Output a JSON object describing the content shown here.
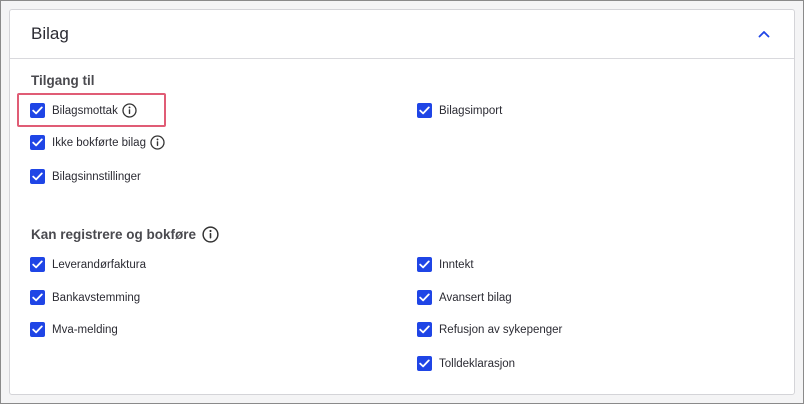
{
  "card": {
    "title": "Bilag",
    "collapse_icon": "chevron-up-icon",
    "accent_color": "#1f45e6",
    "highlight_color": "#e05c75"
  },
  "access": {
    "title": "Tilgang til",
    "items": [
      {
        "label": "Bilagsmottak",
        "checked": true,
        "info": true,
        "highlighted": true
      },
      {
        "label": "Ikke bokførte bilag",
        "checked": true,
        "info": true
      },
      {
        "label": "Bilagsinnstillinger",
        "checked": true
      },
      {
        "label": "Bilagsimport",
        "checked": true
      }
    ]
  },
  "register": {
    "title": "Kan registrere og bokføre",
    "title_info": true,
    "items": [
      {
        "label": "Leverandørfaktura",
        "checked": true
      },
      {
        "label": "Bankavstemming",
        "checked": true
      },
      {
        "label": "Mva-melding",
        "checked": true
      },
      {
        "label": "Inntekt",
        "checked": true
      },
      {
        "label": "Avansert bilag",
        "checked": true
      },
      {
        "label": "Refusjon av sykepenger",
        "checked": true
      },
      {
        "label": "Tolldeklarasjon",
        "checked": true
      }
    ]
  }
}
